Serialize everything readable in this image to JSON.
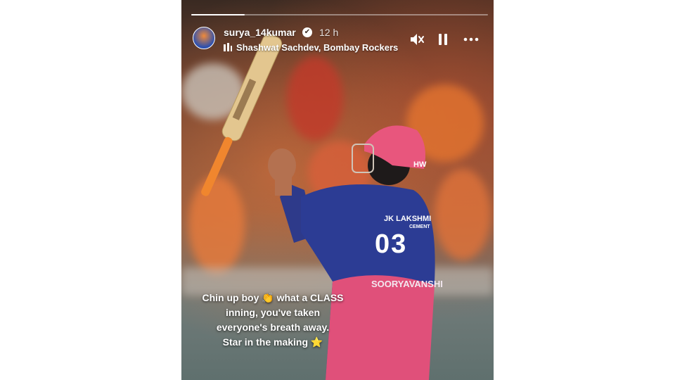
{
  "story": {
    "progress": 0.18,
    "username": "surya_14kumar",
    "verified": "✔",
    "time": "12 h",
    "music": "Shashwat Sachdev, Bombay Rockers",
    "controls": {
      "mute_icon": "speaker-muted-icon",
      "pause_icon": "pause-icon",
      "more_icon": "more-dots-icon"
    },
    "caption": {
      "line1": "Chin up boy 👏 what a CLASS",
      "line2": "inning,  you've taken",
      "line3": "everyone's breath away.",
      "line4": "Star in the making ⭐"
    }
  },
  "photo": {
    "jersey_sponsor": "JK LAKSHMI",
    "jersey_sponsor_sub": "CEMENT",
    "jersey_number": "03",
    "jersey_name": "SOORYAVANSHI",
    "helmet_logo": "HW"
  }
}
